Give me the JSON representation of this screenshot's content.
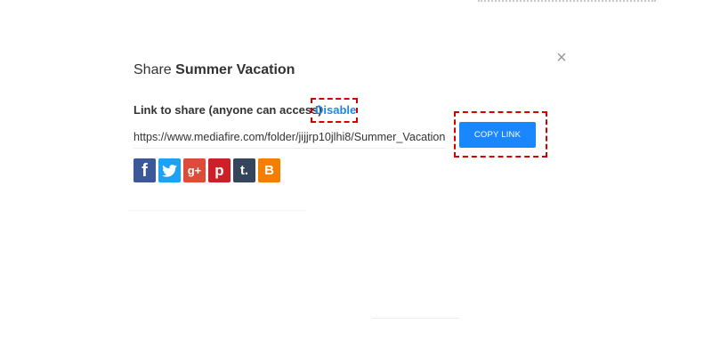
{
  "dialog": {
    "title_prefix": "Share",
    "title_item": "Summer Vacation",
    "close_glyph": "×"
  },
  "share": {
    "label": "Link to share (anyone can access)",
    "disable_label": "Disable",
    "url": "https://www.mediafire.com/folder/jijjrp10jlhi8/Summer_Vacation",
    "copy_button_label": "COPY LINK"
  },
  "social_buttons": [
    {
      "name": "facebook-icon",
      "glyph": "f",
      "color": "#3b5998"
    },
    {
      "name": "twitter-icon",
      "glyph": "",
      "color": "#1da1f2"
    },
    {
      "name": "google-plus-icon",
      "glyph": "g+",
      "color": "#dd4b39"
    },
    {
      "name": "pinterest-icon",
      "glyph": "p",
      "color": "#cb2027"
    },
    {
      "name": "tumblr-icon",
      "glyph": "t.",
      "color": "#35465c"
    },
    {
      "name": "blogger-icon",
      "glyph": "B",
      "color": "#f57d00"
    }
  ],
  "colors": {
    "accent": "#1a86ff",
    "link": "#1e88e5",
    "highlight": "#d60000"
  }
}
